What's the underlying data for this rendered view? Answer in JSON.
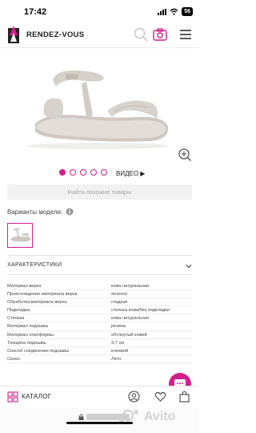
{
  "status": {
    "time": "17:42",
    "battery": "56"
  },
  "header": {
    "brand": "RENDEZ-VOUS",
    "icons": [
      "search-icon",
      "camera-icon",
      "menu-icon"
    ]
  },
  "gallery": {
    "dots_total": 5,
    "active_index": 0,
    "video_label": "ВИДЕО ▶"
  },
  "similar_button": "Найти похожие товары",
  "variants": {
    "label": "Варианты модели:"
  },
  "characteristics": {
    "title": "ХАРАКТЕРИСТИКИ",
    "rows": [
      {
        "name": "Материал верха",
        "value": "кожа натуральная"
      },
      {
        "name": "Происхождение материала верха",
        "value": "ягненок"
      },
      {
        "name": "Обработка материала верха",
        "value": "гладкая"
      },
      {
        "name": "Подкладка",
        "value": "стелька кожа/без подкладки"
      },
      {
        "name": "Стелька",
        "value": "кожа натуральная"
      },
      {
        "name": "Материал подошвы",
        "value": "резина"
      },
      {
        "name": "Материал платформы",
        "value": "обтянутый кожей"
      },
      {
        "name": "Толщина подошвы",
        "value": "3,7 см"
      },
      {
        "name": "Способ соединения подошвы",
        "value": "клеевой"
      },
      {
        "name": "Сезон",
        "value": "Лето"
      }
    ]
  },
  "bottom_bar": {
    "catalog_label": "КАТАЛОГ",
    "icons": [
      "grid-icon",
      "user-icon",
      "heart-icon",
      "bag-icon"
    ]
  },
  "colors": {
    "accent": "#d21f8a",
    "muted": "#a6a6a6"
  }
}
